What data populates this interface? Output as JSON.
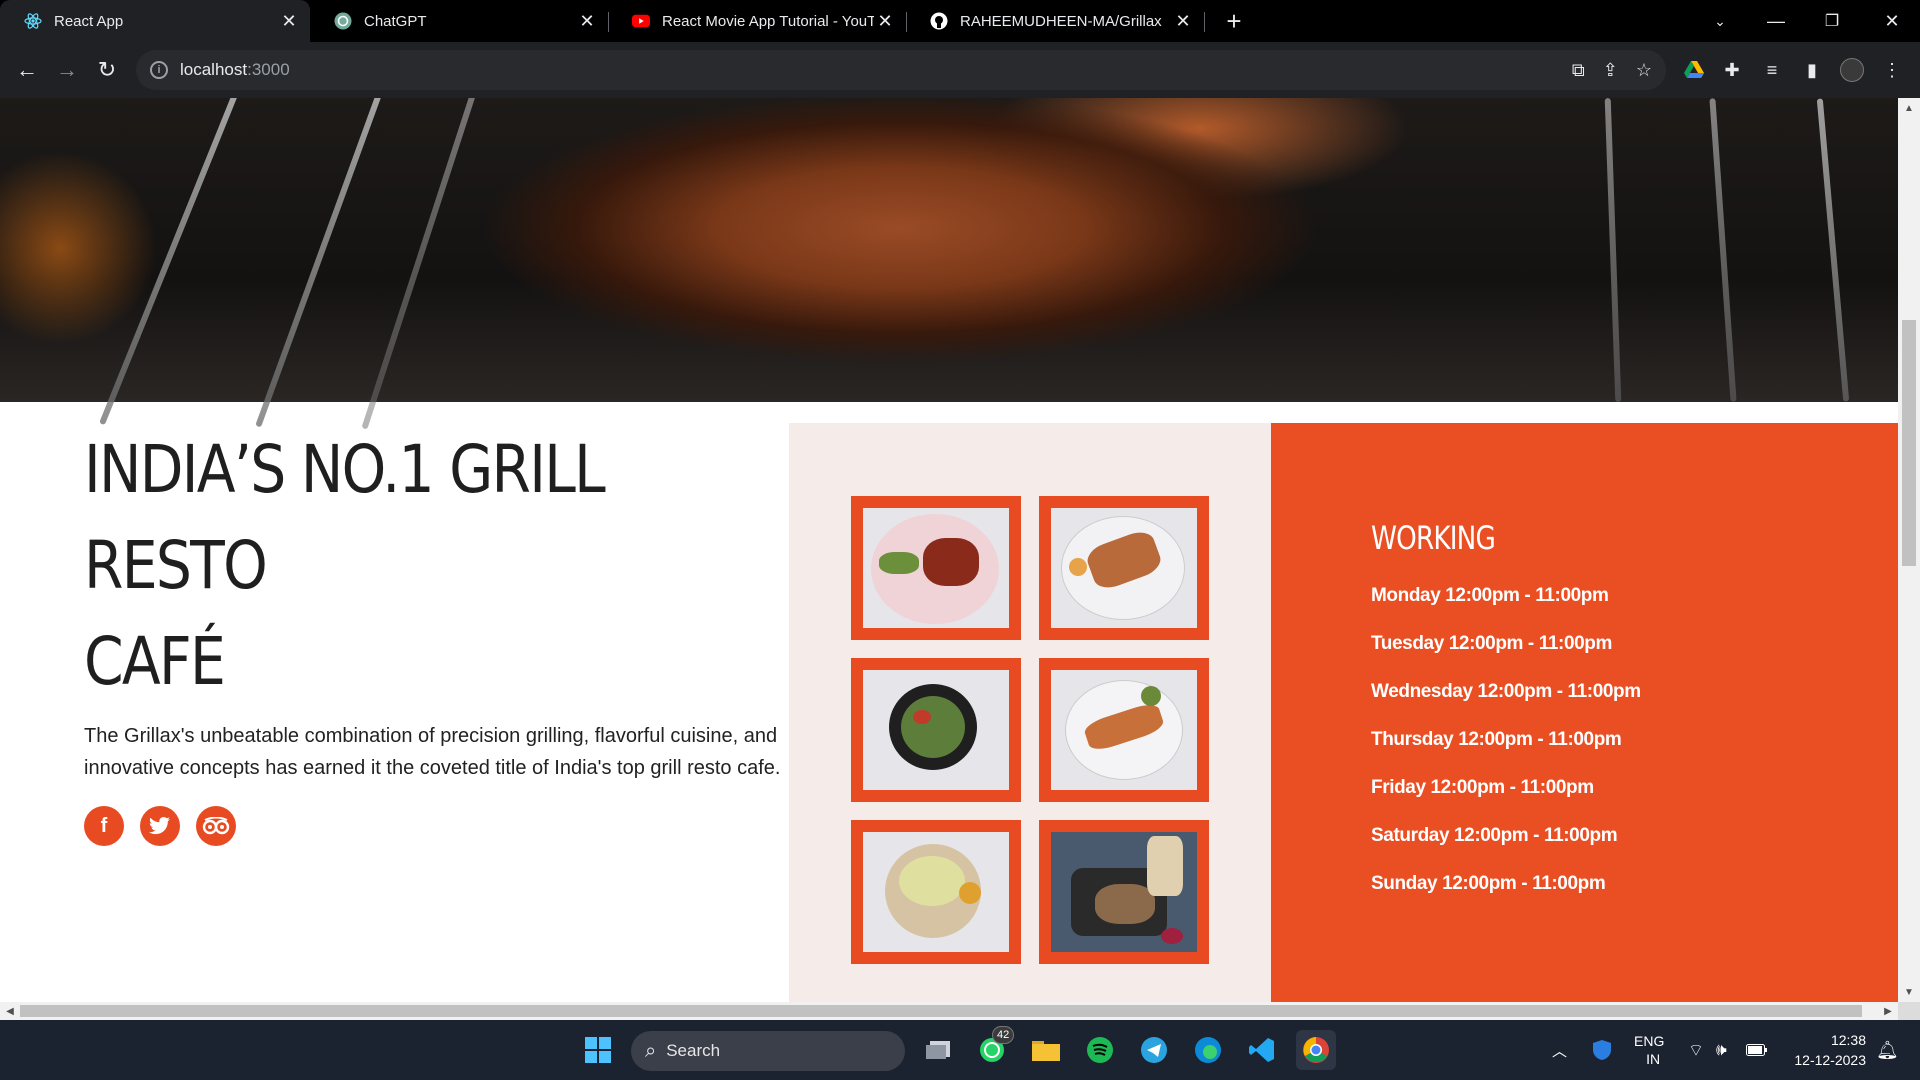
{
  "browser": {
    "tabs": [
      {
        "title": "React App",
        "icon": "react-icon",
        "active": true
      },
      {
        "title": "ChatGPT",
        "icon": "chatgpt-icon",
        "active": false
      },
      {
        "title": "React Movie App Tutorial - YouT",
        "icon": "youtube-icon",
        "active": false
      },
      {
        "title": "RAHEEMUDHEEN-MA/Grillax",
        "icon": "github-icon",
        "active": false
      }
    ],
    "url_host": "localhost",
    "url_port": ":3000"
  },
  "about": {
    "heading_line1": "INDIA’S NO.1 GRILL RESTO",
    "heading_line2": "CAFÉ",
    "description": "The Grillax's unbeatable combination of precision grilling, flavorful cuisine, and innovative concepts has earned it the coveted title of India's top grill resto cafe.",
    "socials": [
      "facebook-icon",
      "twitter-icon",
      "tripadvisor-icon"
    ]
  },
  "gallery": {
    "items": [
      "food-image-1",
      "food-image-2",
      "food-image-3",
      "food-image-4",
      "food-image-5",
      "food-image-6"
    ]
  },
  "hours": {
    "title": "WORKING",
    "days": [
      "Monday 12:00pm - 11:00pm",
      "Tuesday 12:00pm - 11:00pm",
      "Wednesday 12:00pm - 11:00pm",
      "Thursday 12:00pm - 11:00pm",
      "Friday 12:00pm - 11:00pm",
      "Saturday 12:00pm - 11:00pm",
      "Sunday 12:00pm - 11:00pm"
    ]
  },
  "taskbar": {
    "search_label": "Search",
    "whatsapp_badge": "42",
    "lang_line1": "ENG",
    "lang_line2": "IN",
    "time": "12:38",
    "date": "12-12-2023"
  },
  "colors": {
    "accent": "#ea4e23",
    "gallery_bg": "#f5ebe8"
  }
}
